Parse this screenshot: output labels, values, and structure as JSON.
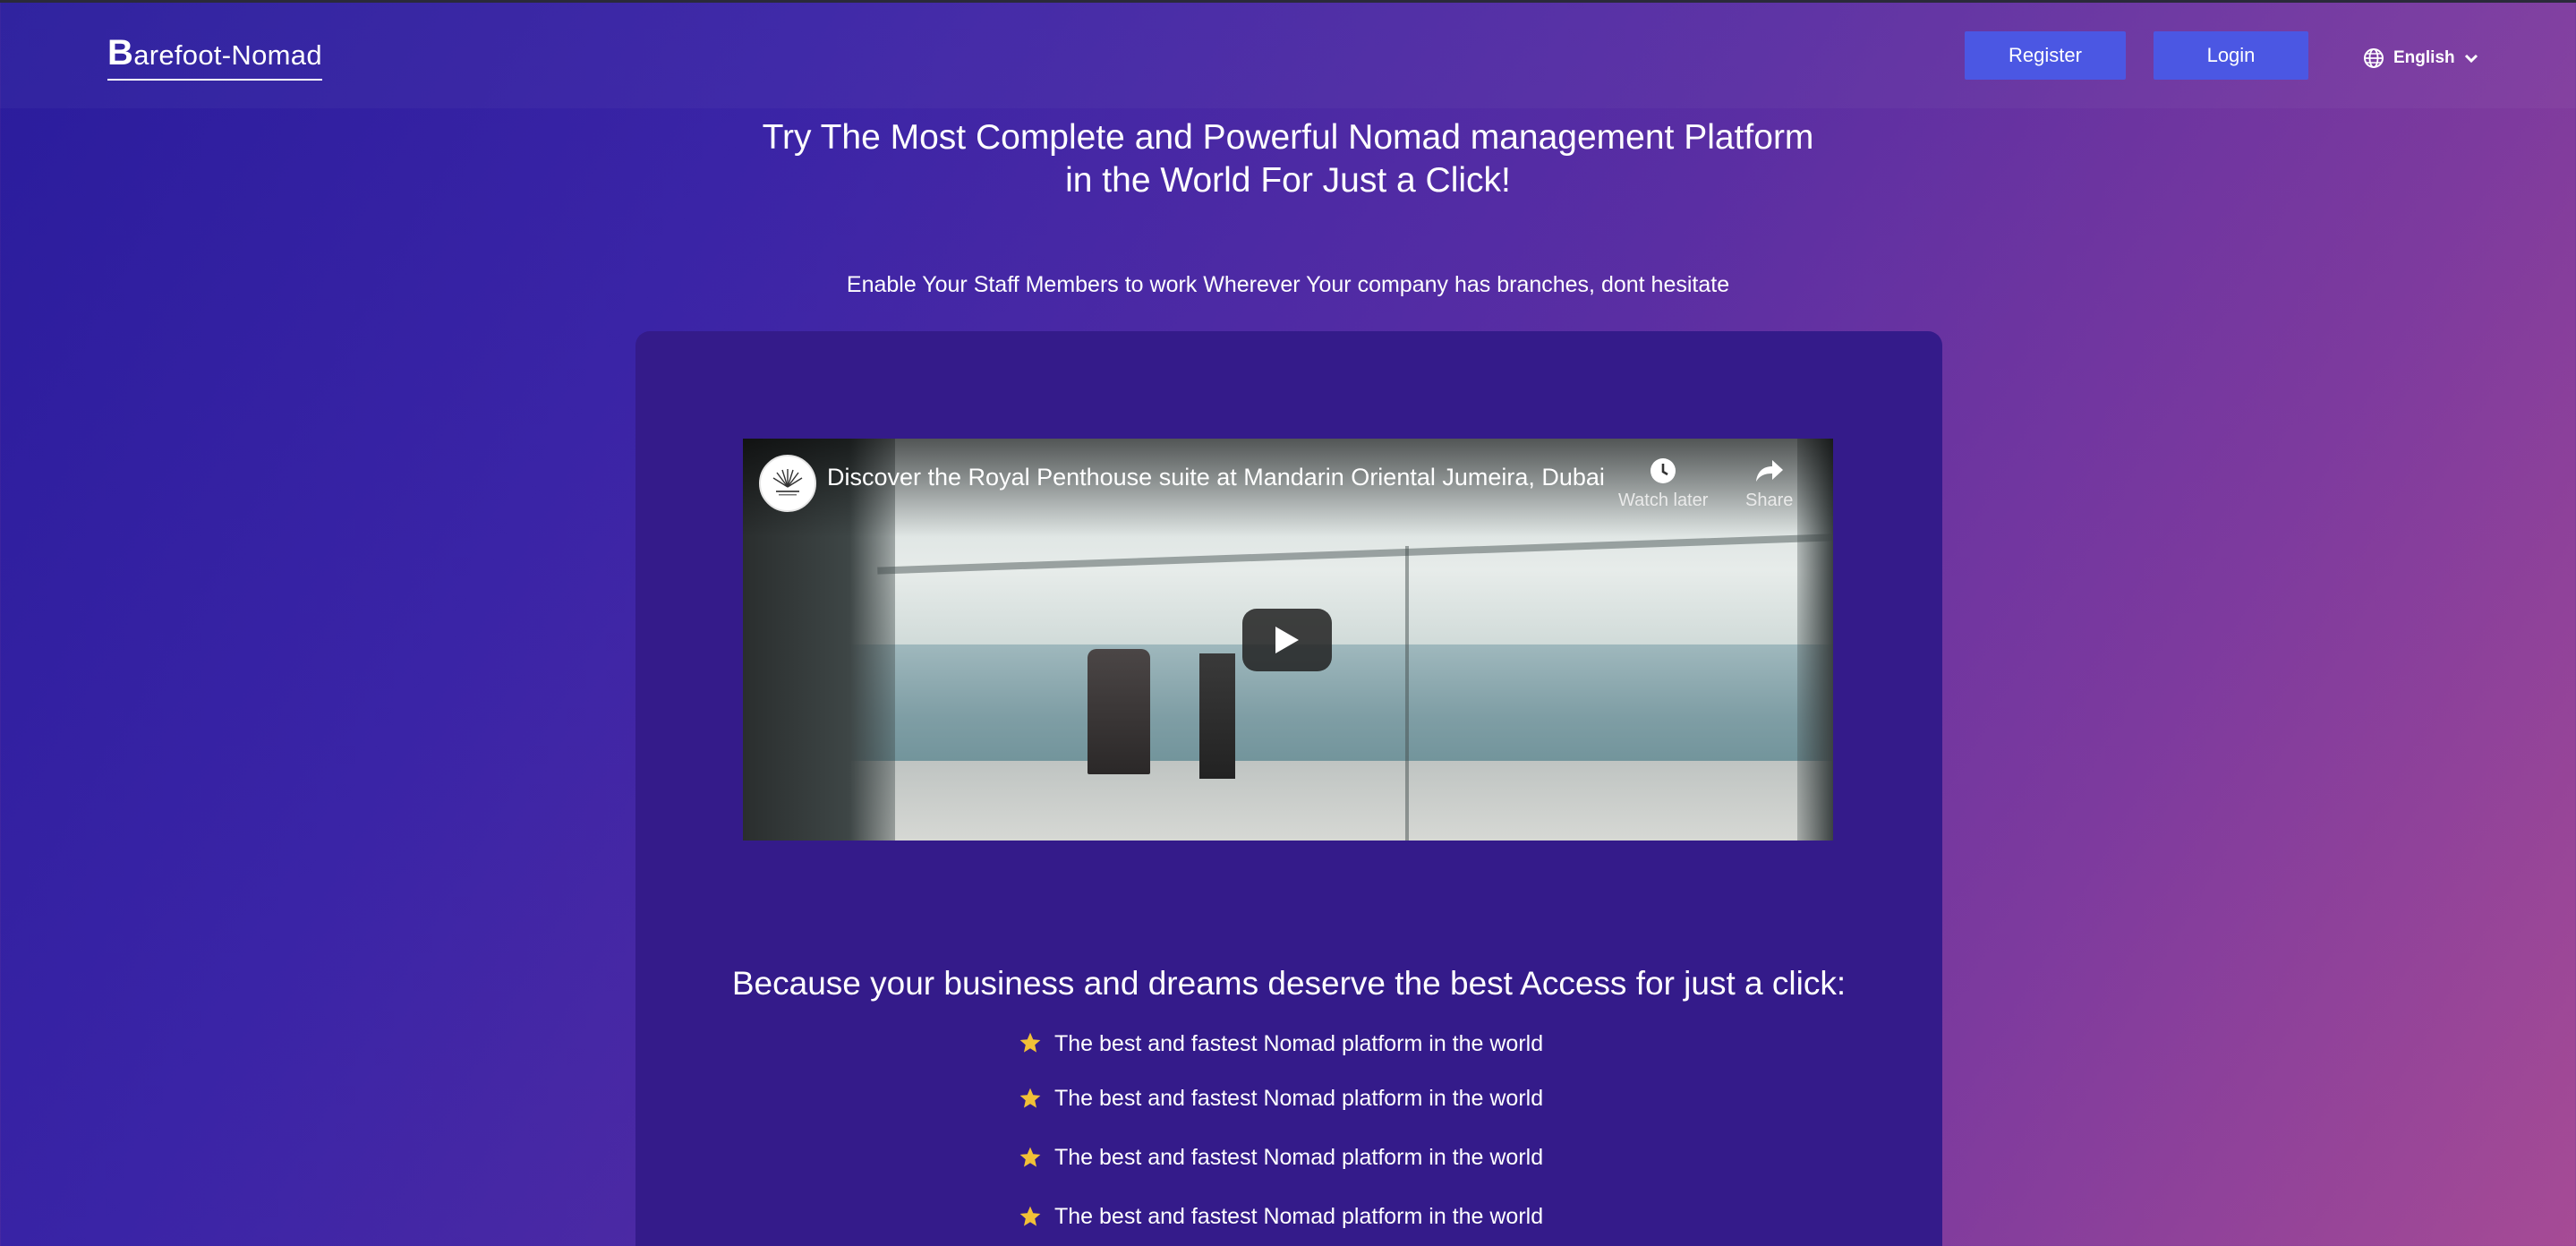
{
  "header": {
    "logo_initial": "B",
    "logo_rest": "arefoot-Nomad",
    "register_label": "Register",
    "login_label": "Login",
    "language": "English"
  },
  "hero": {
    "title_line1": "Try The Most Complete and Powerful Nomad management Platform",
    "title_line2": "in the World For Just a Click!",
    "subtitle": "Enable Your Staff Members to work Wherever Your company has branches, dont hesitate"
  },
  "video": {
    "title": "Discover the Royal Penthouse suite at Mandarin Oriental Jumeira, Dubai",
    "watch_later_label": "Watch later",
    "share_label": "Share"
  },
  "features": {
    "heading": "Because your business and dreams deserve the best Access for just a click:",
    "items": [
      "The best and fastest Nomad platform in the world",
      "The best and fastest Nomad platform in the world",
      "The best and fastest Nomad platform in the world",
      "The best and fastest Nomad platform in the world"
    ]
  },
  "colors": {
    "button": "#4b57e3",
    "card": "#341b8a",
    "star": "#f2c037"
  }
}
